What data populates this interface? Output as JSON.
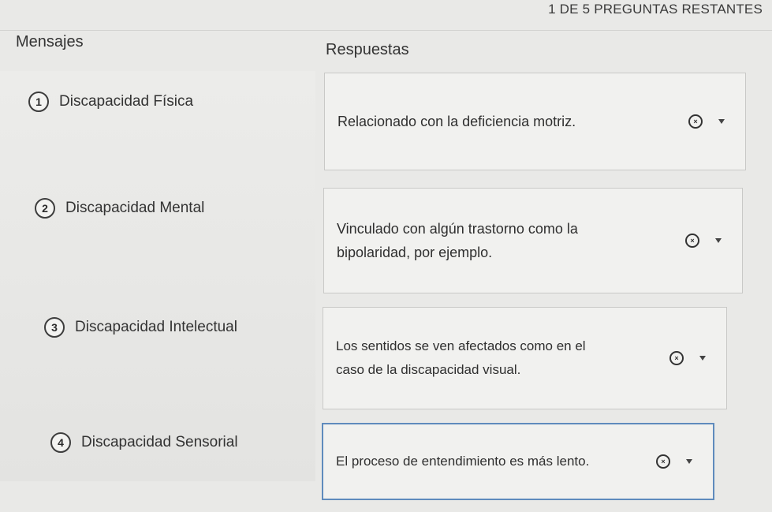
{
  "header": {
    "remaining": "1 DE 5 PREGUNTAS RESTANTES"
  },
  "columns": {
    "messages": "Mensajes",
    "answers": "Respuestas"
  },
  "messages": [
    {
      "number": "1",
      "label": "Discapacidad Física"
    },
    {
      "number": "2",
      "label": "Discapacidad Mental"
    },
    {
      "number": "3",
      "label": "Discapacidad Intelectual"
    },
    {
      "number": "4",
      "label": "Discapacidad Sensorial"
    }
  ],
  "answers": [
    {
      "line1": "Relacionado con la deficiencia motriz.",
      "line2": "",
      "clear_symbol": "×"
    },
    {
      "line1": "Vinculado con algún trastorno como la",
      "line2": "bipolaridad, por ejemplo.",
      "clear_symbol": "×"
    },
    {
      "line1": "Los sentidos se ven afectados como en el",
      "line2": "caso de la discapacidad visual.",
      "clear_symbol": "×"
    },
    {
      "line1": "El proceso de entendimiento es más lento.",
      "line2": "",
      "clear_symbol": "×"
    }
  ],
  "icons": {
    "clear": "circle-x-icon",
    "dropdown": "caret-down-icon"
  },
  "colors": {
    "focus_border": "#5f8bbd",
    "answer_bg": "#f1f1ef",
    "page_bg": "#e9e9e7"
  }
}
